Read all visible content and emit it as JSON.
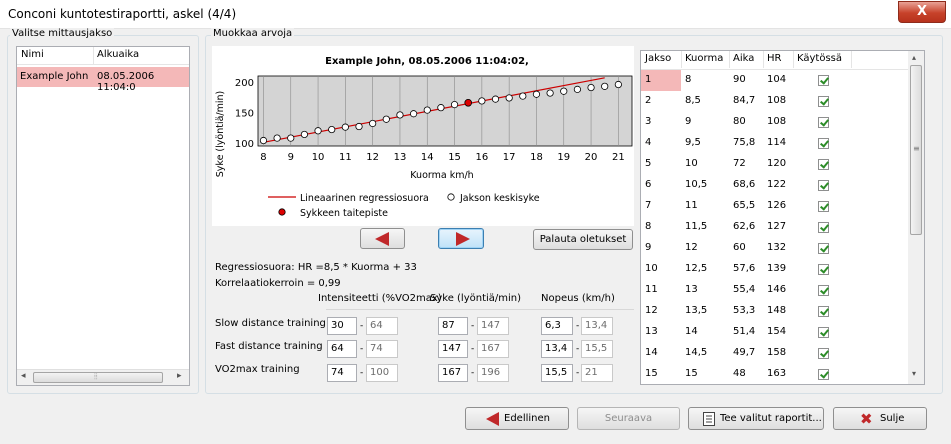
{
  "window": {
    "title": "Conconi kuntotestiraportti, askel (4/4)",
    "close_label": "X"
  },
  "left_panel": {
    "group_label": "Valitse mittausjakso",
    "columns": [
      "Nimi",
      "Alkuaika"
    ],
    "rows": [
      {
        "name": "Example John",
        "start": "08.05.2006 11:04:0"
      }
    ]
  },
  "editor": {
    "group_label": "Muokkaa arvoja",
    "reset_button": "Palauta oletukset",
    "regression_text": "Regressiosuora: HR =8,5 * Kuorma + 33",
    "correlation_text": "Korrelaatiokerroin = 0,99",
    "zone_headers": {
      "intensity": "Intensiteetti (%VO2max)",
      "hr": "Syke (lyöntiä/min)",
      "speed": "Nopeus (km/h)"
    },
    "zones": [
      {
        "label": "Slow distance training",
        "int_from": "30",
        "int_to": "64",
        "hr_from": "87",
        "hr_to": "147",
        "sp_from": "6,3",
        "sp_to": "13,4"
      },
      {
        "label": "Fast distance training",
        "int_from": "64",
        "int_to": "74",
        "hr_from": "147",
        "hr_to": "167",
        "sp_from": "13,4",
        "sp_to": "15,5"
      },
      {
        "label": "VO2max training",
        "int_from": "74",
        "int_to": "100",
        "hr_from": "167",
        "hr_to": "196",
        "sp_from": "15,5",
        "sp_to": "21"
      }
    ]
  },
  "chart_data": {
    "type": "scatter",
    "title": "Example John, 08.05.2006 11:04:02,",
    "xlabel": "Kuorma km/h",
    "ylabel": "Syke (lyöntiä/min)",
    "xlim": [
      7.8,
      21.5
    ],
    "ylim": [
      95,
      210
    ],
    "xticks": [
      8,
      9,
      10,
      11,
      12,
      13,
      14,
      15,
      16,
      17,
      18,
      19,
      20,
      21
    ],
    "yticks": [
      100,
      150,
      200
    ],
    "series": [
      {
        "name": "Jakson keskisyke",
        "x": [
          8,
          8.5,
          9,
          9.5,
          10,
          10.5,
          11,
          11.5,
          12,
          12.5,
          13,
          13.5,
          14,
          14.5,
          15,
          15.5,
          16,
          16.5,
          17,
          17.5,
          18,
          18.5,
          19,
          19.5,
          20,
          20.5,
          21
        ],
        "y": [
          104,
          108,
          108,
          114,
          120,
          122,
          126,
          127,
          132,
          139,
          146,
          148,
          154,
          158,
          163,
          166,
          169,
          172,
          174,
          177,
          180,
          182,
          185,
          188,
          191,
          193,
          196
        ]
      },
      {
        "name": "Lineaarinen regressiosuora",
        "x": [
          8,
          20.5
        ],
        "y": [
          101,
          207
        ]
      },
      {
        "name": "Sykkeen taitepiste",
        "x": [
          15.5
        ],
        "y": [
          166
        ]
      }
    ],
    "legend": [
      "Lineaarinen regressiosuora",
      "Jakson keskisyke",
      "Sykkeen taitepiste"
    ],
    "colors": {
      "regression": "#cc0000",
      "breakpoint": "#dd0000",
      "plot_bg": "#d4d4d4"
    }
  },
  "grid": {
    "columns": [
      "Jakso",
      "Kuorma",
      "Aika",
      "HR",
      "Käytössä"
    ],
    "rows": [
      [
        "1",
        "8",
        "90",
        "104"
      ],
      [
        "2",
        "8,5",
        "84,7",
        "108"
      ],
      [
        "3",
        "9",
        "80",
        "108"
      ],
      [
        "4",
        "9,5",
        "75,8",
        "114"
      ],
      [
        "5",
        "10",
        "72",
        "120"
      ],
      [
        "6",
        "10,5",
        "68,6",
        "122"
      ],
      [
        "7",
        "11",
        "65,5",
        "126"
      ],
      [
        "8",
        "11,5",
        "62,6",
        "127"
      ],
      [
        "9",
        "12",
        "60",
        "132"
      ],
      [
        "10",
        "12,5",
        "57,6",
        "139"
      ],
      [
        "11",
        "13",
        "55,4",
        "146"
      ],
      [
        "12",
        "13,5",
        "53,3",
        "148"
      ],
      [
        "13",
        "14",
        "51,4",
        "154"
      ],
      [
        "14",
        "14,5",
        "49,7",
        "158"
      ],
      [
        "15",
        "15",
        "48",
        "163"
      ]
    ]
  },
  "footer": {
    "prev": "Edellinen",
    "next": "Seuraava",
    "report": "Tee valitut raportit...",
    "close": "Sulje"
  }
}
